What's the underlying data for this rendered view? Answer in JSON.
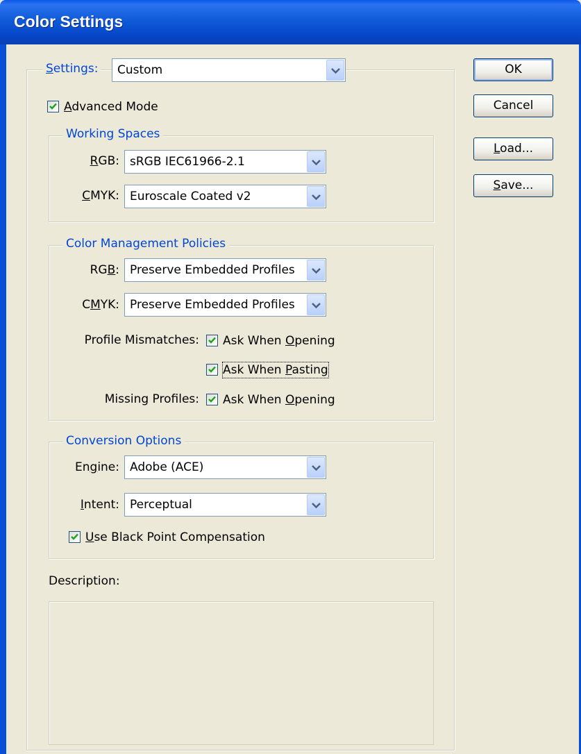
{
  "window": {
    "title": "Color Settings"
  },
  "settings": {
    "label_pre": "",
    "label_key": "S",
    "label_post": "ettings:",
    "value": "Custom",
    "advanced_mode": {
      "checked": true,
      "key": "A",
      "post": "dvanced Mode"
    }
  },
  "working_spaces": {
    "title": "Working Spaces",
    "rgb": {
      "pre": "",
      "key": "R",
      "post": "GB:",
      "value": "sRGB IEC61966-2.1"
    },
    "cmyk": {
      "pre": "",
      "key": "C",
      "post": "MYK:",
      "value": "Euroscale Coated v2"
    }
  },
  "policies": {
    "title": "Color Management Policies",
    "rgb": {
      "pre": "RG",
      "key": "B",
      "post": ":",
      "value": "Preserve Embedded Profiles"
    },
    "cmyk": {
      "pre": "C",
      "key": "M",
      "post": "YK:",
      "value": "Preserve Embedded Profiles"
    },
    "profile_mismatches_label": "Profile Mismatches:",
    "ask_opening": {
      "checked": true,
      "pre": "Ask When ",
      "key": "O",
      "post": "pening"
    },
    "ask_pasting": {
      "checked": true,
      "pre": "Ask When ",
      "key": "P",
      "post": "asting"
    },
    "missing_profiles_label": "Missing Profiles:",
    "missing_ask_opening": {
      "checked": true,
      "pre": "Ask When ",
      "key": "O",
      "post": "pening"
    }
  },
  "conversion": {
    "title": "Conversion Options",
    "engine": {
      "pre": "En",
      "key": "g",
      "post": "ine:",
      "value": "Adobe (ACE)"
    },
    "intent": {
      "pre": "",
      "key": "I",
      "post": "ntent:",
      "value": "Perceptual"
    },
    "black_point": {
      "checked": true,
      "pre": "",
      "key": "U",
      "post": "se Black Point Compensation"
    }
  },
  "description": {
    "label": "Description:",
    "text": ""
  },
  "buttons": {
    "ok": {
      "pre": "OK",
      "key": "",
      "post": ""
    },
    "cancel": {
      "pre": "Cancel",
      "key": "",
      "post": ""
    },
    "load": {
      "pre": "",
      "key": "L",
      "post": "oad..."
    },
    "save": {
      "pre": "",
      "key": "S",
      "post": "ave..."
    }
  },
  "icons": {
    "dropdown": "chevron-down-icon",
    "check": "checkmark-icon"
  },
  "colors": {
    "title_bar": "#0a58e8",
    "group_title": "#0046d5",
    "dialog_bg": "#ece9d8"
  }
}
